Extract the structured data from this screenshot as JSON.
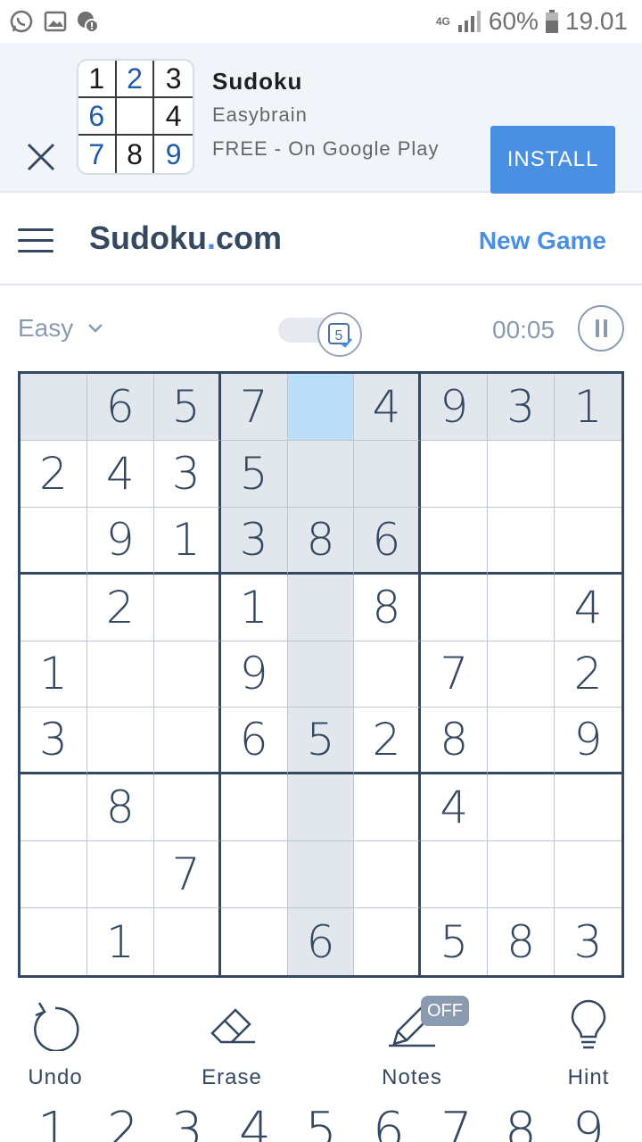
{
  "status_bar": {
    "network": "4G",
    "battery": "60%",
    "time": "19.01"
  },
  "ad": {
    "app_name": "Sudoku",
    "developer": "Easybrain",
    "price_line": "FREE - On Google Play",
    "install_label": "INSTALL",
    "logo_digits": [
      "1",
      "2",
      "3",
      "6",
      "",
      "4",
      "7",
      "8",
      "9"
    ]
  },
  "header": {
    "logo_main": "Sudoku",
    "logo_dot": ".",
    "logo_tld": "com",
    "new_game_label": "New Game"
  },
  "info": {
    "difficulty": "Easy",
    "auto_check_count": "5",
    "timer": "00:05"
  },
  "board": {
    "rows": [
      [
        "",
        "6",
        "5",
        "7",
        "",
        "4",
        "9",
        "3",
        "1"
      ],
      [
        "2",
        "4",
        "3",
        "5",
        "",
        "",
        "",
        "",
        ""
      ],
      [
        "",
        "9",
        "1",
        "3",
        "8",
        "6",
        "",
        "",
        ""
      ],
      [
        "",
        "2",
        "",
        "1",
        "",
        "8",
        "",
        "",
        "4"
      ],
      [
        "1",
        "",
        "",
        "9",
        "",
        "",
        "7",
        "",
        "2"
      ],
      [
        "3",
        "",
        "",
        "6",
        "5",
        "2",
        "8",
        "",
        "9"
      ],
      [
        "",
        "8",
        "",
        "",
        "",
        "",
        "4",
        "",
        ""
      ],
      [
        "",
        "",
        "7",
        "",
        "",
        "",
        "",
        "",
        ""
      ],
      [
        "",
        "1",
        "",
        "",
        "6",
        "",
        "5",
        "8",
        "3"
      ]
    ],
    "selected": {
      "row": 1,
      "col": 5
    }
  },
  "controls": {
    "undo": "Undo",
    "erase": "Erase",
    "notes": "Notes",
    "notes_state": "OFF",
    "hint": "Hint"
  },
  "numpad": [
    "1",
    "2",
    "3",
    "4",
    "5",
    "6",
    "7",
    "8",
    "9"
  ]
}
